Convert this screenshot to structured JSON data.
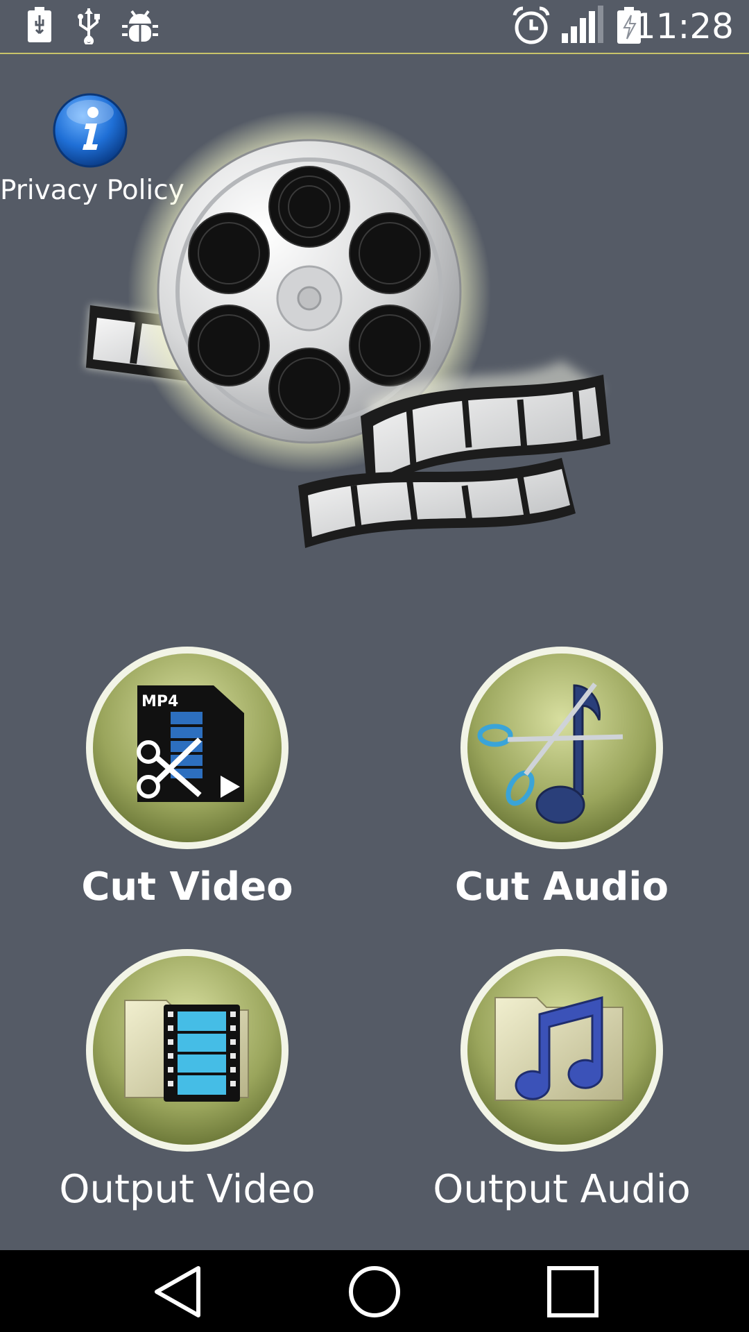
{
  "status_bar": {
    "time": "11:28",
    "left_icons": [
      "battery-usb-icon",
      "usb-icon",
      "android-debug-icon"
    ],
    "right_icons": [
      "alarm-icon",
      "signal-icon",
      "battery-charging-icon"
    ]
  },
  "privacy": {
    "label": "Privacy Policy",
    "icon": "info-icon"
  },
  "hero": {
    "icon": "film-reel-icon"
  },
  "actions": [
    {
      "label": "Cut Video",
      "icon": "cut-video-icon"
    },
    {
      "label": "Cut Audio",
      "icon": "cut-audio-icon"
    },
    {
      "label": "Output Video",
      "icon": "output-video-folder-icon"
    },
    {
      "label": "Output Audio",
      "icon": "output-audio-folder-icon"
    }
  ],
  "nav_bar": {
    "buttons": [
      "back-icon",
      "home-icon",
      "recents-icon"
    ]
  },
  "colors": {
    "background": "#555b66",
    "circle_green": "#a6b066",
    "circle_ring": "#f2f4e6",
    "accent_line": "#c9c36a",
    "info_blue": "#1f6fd6"
  }
}
